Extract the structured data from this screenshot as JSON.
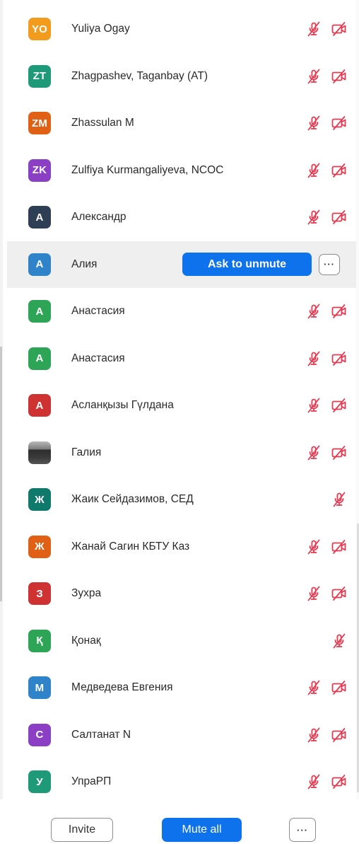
{
  "participants": [
    {
      "initials": "YO",
      "name": "Yuliya Ogay",
      "color": "#f29b1d",
      "mic": "mic-muted-icon",
      "video": "video-off-icon"
    },
    {
      "initials": "ZT",
      "name": "Zhagpashev, Taganbay (AT)",
      "color": "#1f9a78",
      "mic": "mic-muted-icon",
      "video": "video-off-icon"
    },
    {
      "initials": "ZM",
      "name": "Zhassulan M",
      "color": "#e06016",
      "mic": "mic-muted-icon",
      "video": "video-off-icon"
    },
    {
      "initials": "ZK",
      "name": "Zulfiya Kurmangaliyeva, NCOC",
      "color": "#8b3fc4",
      "mic": "mic-muted-icon",
      "video": "video-off-icon"
    },
    {
      "initials": "A",
      "name": "Александр",
      "color": "#2e3f55",
      "mic": "mic-muted-icon",
      "video": "video-off-icon"
    },
    {
      "initials": "A",
      "name": "Алия",
      "color": "#2f83c9",
      "hover": true
    },
    {
      "initials": "A",
      "name": "Анастасия",
      "color": "#2ea556",
      "mic": "mic-muted-icon",
      "video": "video-off-icon"
    },
    {
      "initials": "A",
      "name": "Анастасия",
      "color": "#2ea556",
      "mic": "mic-muted-icon",
      "video": "video-off-icon"
    },
    {
      "initials": "A",
      "name": "Асланқызы Гүлдана",
      "color": "#cf3232",
      "mic": "mic-muted-icon",
      "video": "video-off-icon"
    },
    {
      "initials": "",
      "name": "Галия",
      "photo": true,
      "mic": "mic-muted-icon",
      "video": "video-off-icon"
    },
    {
      "initials": "Ж",
      "name": "Жаик Сейдазимов, СЕД",
      "color": "#0f7a6c",
      "mic": "mic-muted-icon"
    },
    {
      "initials": "Ж",
      "name": "Жанай Сагин КБТУ Каз",
      "color": "#e06016",
      "mic": "mic-muted-icon",
      "video": "video-off-icon"
    },
    {
      "initials": "З",
      "name": "Зухра",
      "color": "#cf3232",
      "mic": "mic-muted-icon",
      "video": "video-off-icon"
    },
    {
      "initials": "Қ",
      "name": "Қонақ",
      "color": "#2ea556",
      "mic": "mic-muted-icon"
    },
    {
      "initials": "М",
      "name": "Медведева Евгения",
      "color": "#2f83c9",
      "mic": "mic-muted-icon",
      "video": "video-off-icon"
    },
    {
      "initials": "С",
      "name": "Салтанат N",
      "color": "#8b3fc4",
      "mic": "mic-muted-icon",
      "video": "video-off-icon"
    },
    {
      "initials": "У",
      "name": "УпраРП",
      "color": "#1f9a78",
      "mic": "mic-muted-icon",
      "video": "video-off-icon"
    }
  ],
  "hover_actions": {
    "ask_to_unmute": "Ask to unmute",
    "more": "···"
  },
  "footer": {
    "invite": "Invite",
    "mute_all": "Mute all",
    "more": "···"
  },
  "colors": {
    "accent": "#0e72ed",
    "muted_red": "#e8384f"
  }
}
